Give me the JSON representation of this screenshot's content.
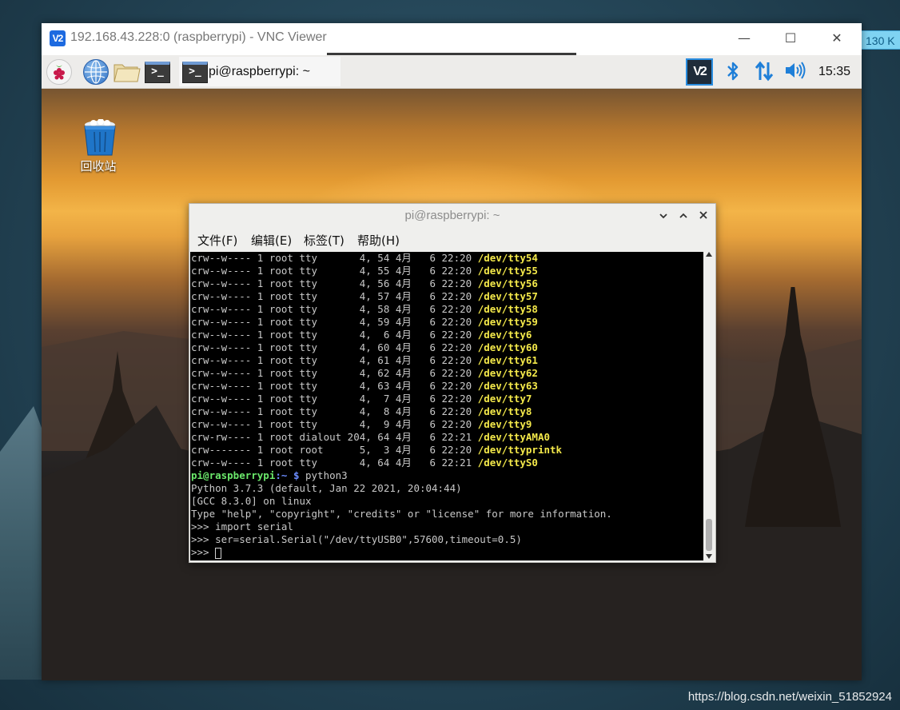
{
  "desktop": {
    "side_tag": "130 K",
    "watermark": "https://blog.csdn.net/weixin_51852924"
  },
  "vnc": {
    "title": "192.168.43.228:0 (raspberrypi) - VNC Viewer",
    "logo": "V2",
    "controls": {
      "minimize": "—",
      "maximize": "☐",
      "close": "✕"
    }
  },
  "taskbar": {
    "launchers": [
      "raspberry-menu-icon",
      "web-browser-icon",
      "file-manager-icon",
      "terminal-icon"
    ],
    "task_window_label": "pi@raspberrypi: ~",
    "tray": {
      "vnc_icon": "V2",
      "bluetooth_icon": "bluetooth-icon",
      "network_icon": "network-arrows-icon",
      "volume_icon": "volume-icon",
      "clock": "15:35"
    }
  },
  "desktop_icons": [
    {
      "label": "回收站",
      "icon": "trash-icon"
    }
  ],
  "terminal": {
    "title": "pi@raspberrypi: ~",
    "controls": {
      "minimize": "⌄",
      "maximize": "⌃",
      "close": "✕"
    },
    "menus": [
      "文件(F)",
      "编辑(E)",
      "标签(T)",
      "帮助(H)"
    ],
    "listing": [
      {
        "text": "crw--w---- 1 root tty       4, 54 4月   6 22:20 ",
        "dev": "/dev/tty54"
      },
      {
        "text": "crw--w---- 1 root tty       4, 55 4月   6 22:20 ",
        "dev": "/dev/tty55"
      },
      {
        "text": "crw--w---- 1 root tty       4, 56 4月   6 22:20 ",
        "dev": "/dev/tty56"
      },
      {
        "text": "crw--w---- 1 root tty       4, 57 4月   6 22:20 ",
        "dev": "/dev/tty57"
      },
      {
        "text": "crw--w---- 1 root tty       4, 58 4月   6 22:20 ",
        "dev": "/dev/tty58"
      },
      {
        "text": "crw--w---- 1 root tty       4, 59 4月   6 22:20 ",
        "dev": "/dev/tty59"
      },
      {
        "text": "crw--w---- 1 root tty       4,  6 4月   6 22:20 ",
        "dev": "/dev/tty6"
      },
      {
        "text": "crw--w---- 1 root tty       4, 60 4月   6 22:20 ",
        "dev": "/dev/tty60"
      },
      {
        "text": "crw--w---- 1 root tty       4, 61 4月   6 22:20 ",
        "dev": "/dev/tty61"
      },
      {
        "text": "crw--w---- 1 root tty       4, 62 4月   6 22:20 ",
        "dev": "/dev/tty62"
      },
      {
        "text": "crw--w---- 1 root tty       4, 63 4月   6 22:20 ",
        "dev": "/dev/tty63"
      },
      {
        "text": "crw--w---- 1 root tty       4,  7 4月   6 22:20 ",
        "dev": "/dev/tty7"
      },
      {
        "text": "crw--w---- 1 root tty       4,  8 4月   6 22:20 ",
        "dev": "/dev/tty8"
      },
      {
        "text": "crw--w---- 1 root tty       4,  9 4月   6 22:20 ",
        "dev": "/dev/tty9"
      },
      {
        "text": "crw-rw---- 1 root dialout 204, 64 4月   6 22:21 ",
        "dev": "/dev/ttyAMA0"
      },
      {
        "text": "crw------- 1 root root      5,  3 4月   6 22:20 ",
        "dev": "/dev/ttyprintk"
      },
      {
        "text": "crw--w---- 1 root tty       4, 64 4月   6 22:21 ",
        "dev": "/dev/ttyS0"
      }
    ],
    "prompt": {
      "user": "pi@raspberrypi",
      "path": ":~",
      "symbol": " $ ",
      "command": "python3"
    },
    "output": [
      "Python 3.7.3 (default, Jan 22 2021, 20:04:44)",
      "[GCC 8.3.0] on linux",
      "Type \"help\", \"copyright\", \"credits\" or \"license\" for more information.",
      ">>> import serial",
      ">>> ser=serial.Serial(\"/dev/ttyUSB0\",57600,timeout=0.5)"
    ],
    "input_prompt": ">>> "
  },
  "colors": {
    "dev_yellow": "#f4e94a",
    "prompt_green": "#6be86b",
    "prompt_blue": "#6b8cff",
    "accent_blue": "#1f7fd8"
  }
}
